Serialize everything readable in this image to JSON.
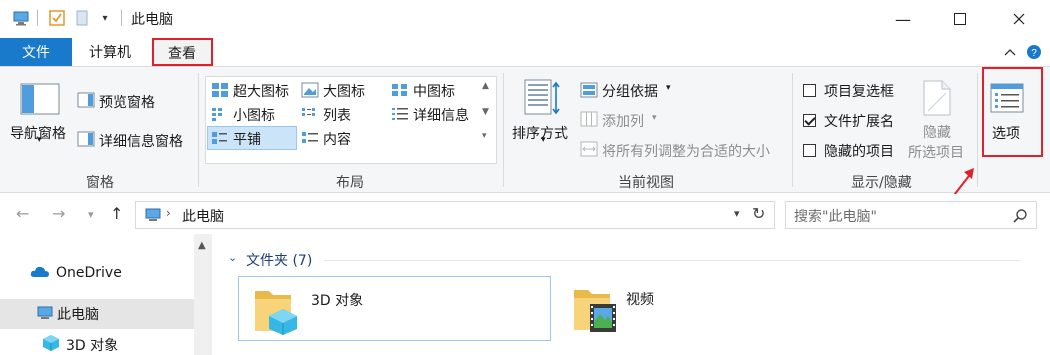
{
  "window": {
    "title": "此电脑",
    "minimize": "—",
    "maximize": "☐",
    "close": "✕"
  },
  "tabs": {
    "file": "文件",
    "computer": "计算机",
    "view": "查看"
  },
  "ribbon": {
    "panes": {
      "nav_pane": "导航窗格",
      "preview_pane": "预览窗格",
      "details_pane": "详细信息窗格",
      "label": "窗格"
    },
    "layout": {
      "extra_large": "超大图标",
      "large": "大图标",
      "medium": "中图标",
      "small": "小图标",
      "list": "列表",
      "details": "详细信息",
      "tiles": "平铺",
      "content": "内容",
      "label": "布局"
    },
    "current_view": {
      "sort_by": "排序方式",
      "group_by": "分组依据",
      "add_columns": "添加列",
      "size_all_columns": "将所有列调整为合适的大小",
      "label": "当前视图"
    },
    "show_hide": {
      "item_checkboxes": "项目复选框",
      "file_extensions": "文件扩展名",
      "hidden_items": "隐藏的项目",
      "hide_selected_line1": "隐藏",
      "hide_selected_line2": "所选项目",
      "label": "显示/隐藏",
      "checkbox_states": {
        "item_checkboxes": false,
        "file_extensions": true,
        "hidden_items": false
      }
    },
    "options": "选项"
  },
  "address": {
    "path": "此电脑",
    "search_placeholder": "搜索\"此电脑\""
  },
  "nav_pane": {
    "items": [
      {
        "label": "OneDrive"
      },
      {
        "label": "此电脑"
      },
      {
        "label": "3D 对象"
      }
    ]
  },
  "content": {
    "group_header": "文件夹 (7)",
    "folders": [
      {
        "name": "3D 对象"
      },
      {
        "name": "视频"
      }
    ]
  },
  "colors": {
    "accent": "#1979ca",
    "highlight_border": "#e0202a",
    "selection_bg": "#cce4f7"
  }
}
